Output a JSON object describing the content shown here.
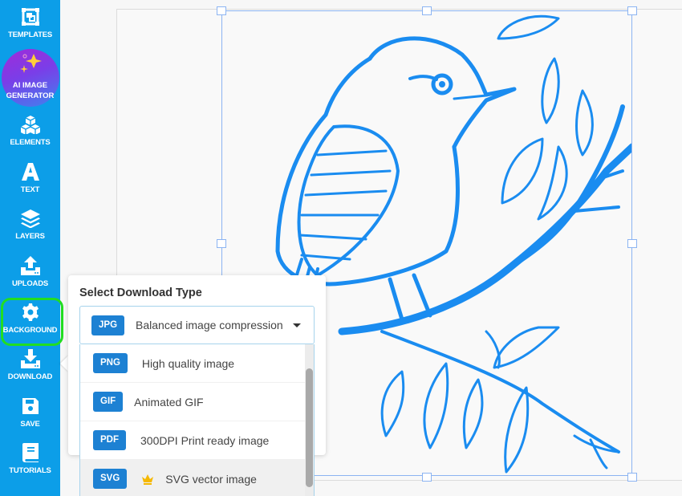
{
  "sidebar": {
    "accent_color": "#0c9ee8",
    "highlight_color": "#22dd22",
    "items": [
      {
        "id": "templates",
        "label": "TEMPLATES",
        "icon": "templates-icon"
      },
      {
        "id": "ai",
        "label_line1": "AI IMAGE",
        "label_line2": "GENERATOR",
        "icon": "sparkle-icon"
      },
      {
        "id": "elements",
        "label": "ELEMENTS",
        "icon": "cubes-icon"
      },
      {
        "id": "text",
        "label": "TEXT",
        "icon": "letter-a-icon"
      },
      {
        "id": "layers",
        "label": "LAYERS",
        "icon": "layers-icon"
      },
      {
        "id": "uploads",
        "label": "UPLOADS",
        "icon": "upload-icon"
      },
      {
        "id": "background",
        "label": "BACKGROUND",
        "icon": "gear-icon"
      },
      {
        "id": "download",
        "label": "DOWNLOAD",
        "icon": "download-icon"
      },
      {
        "id": "save",
        "label": "SAVE",
        "icon": "floppy-disk-icon"
      },
      {
        "id": "tutorials",
        "label": "TUTORIALS",
        "icon": "book-icon"
      }
    ]
  },
  "canvas": {
    "image": "blue line-art bird perched on branch",
    "ink_color": "#1a8cf0"
  },
  "download_popover": {
    "title": "Select Download Type",
    "selected": {
      "badge": "JPG",
      "label": "Balanced image compression"
    },
    "badge_color": "#1d81d3",
    "options": [
      {
        "badge": "PNG",
        "label": "High quality image",
        "premium": false
      },
      {
        "badge": "GIF",
        "label": "Animated GIF",
        "premium": false
      },
      {
        "badge": "PDF",
        "label": "300DPI Print ready image",
        "premium": false
      },
      {
        "badge": "SVG",
        "label": "SVG vector image",
        "premium": true
      }
    ]
  }
}
